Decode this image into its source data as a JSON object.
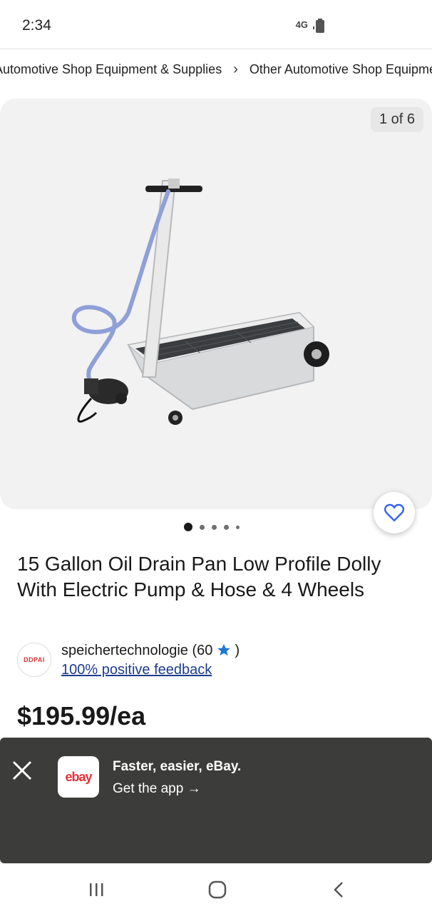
{
  "status": {
    "time": "2:34",
    "network": "4G"
  },
  "breadcrumb": {
    "items": [
      "Automotive Shop Equipment & Supplies",
      "Other Automotive Shop Equipment"
    ]
  },
  "gallery": {
    "counter": "1 of 6",
    "current_index": 1,
    "total": 6
  },
  "product": {
    "title": "15 Gallon Oil Drain Pan Low Profile Dolly With Electric Pump & Hose & 4 Wheels",
    "price": "$195.99/ea"
  },
  "seller": {
    "logo_text": "DDPAI",
    "name": "speichertechnologie (60",
    "name_suffix": ")",
    "feedback": "100% positive feedback"
  },
  "banner": {
    "app_logo_text": "ebay",
    "title": "Faster, easier, eBay.",
    "cta": "Get the app →"
  },
  "colors": {
    "accent_blue": "#3665f3",
    "banner_bg": "#3c3c3a",
    "link_blue": "#1d3c8c",
    "star_blue": "#1f77d4"
  }
}
